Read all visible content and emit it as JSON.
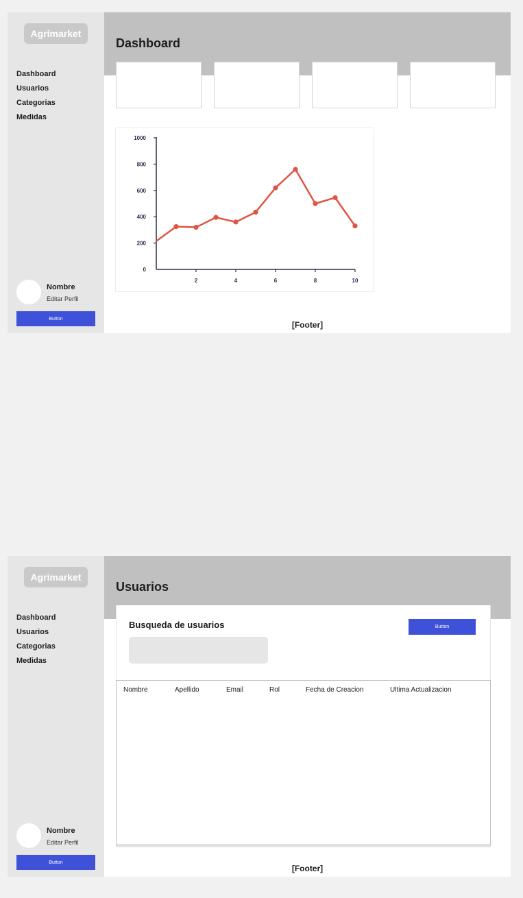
{
  "brand": "Agrimarket",
  "nav": [
    "Dashboard",
    "Usuarios",
    "Categorias",
    "Medidas"
  ],
  "profile": {
    "name": "Nombre",
    "edit_label": "Editar Perfil",
    "button_label": "Button"
  },
  "footer": "[Footer]",
  "dashboard": {
    "title": "Dashboard"
  },
  "usuarios": {
    "title": "Usuarios",
    "search_title": "Busqueda de usuarios",
    "button_label": "Button",
    "search_placeholder": "",
    "table_headers": [
      "Nombre",
      "Apellido",
      "Email",
      "Rol",
      "Fecha de Creacion",
      "Ultima Actualizacion"
    ]
  },
  "colors": {
    "accent": "#3f51d8",
    "line": "#e05444",
    "sidebar": "#e6e6e6",
    "header": "#c0c0c0"
  },
  "chart_data": {
    "type": "line",
    "x": [
      0,
      1,
      2,
      3,
      4,
      5,
      6,
      7,
      8,
      9,
      10
    ],
    "series": [
      {
        "values": [
          215,
          325,
          320,
          395,
          360,
          435,
          620,
          760,
          500,
          545,
          330
        ]
      }
    ],
    "xticks": [
      2,
      4,
      6,
      8,
      10
    ],
    "yticks": [
      0,
      200,
      400,
      600,
      800,
      1000
    ],
    "xlim": [
      0,
      10
    ],
    "ylim": [
      0,
      1000
    ],
    "title": "",
    "xlabel": "",
    "ylabel": "",
    "grid": false
  }
}
